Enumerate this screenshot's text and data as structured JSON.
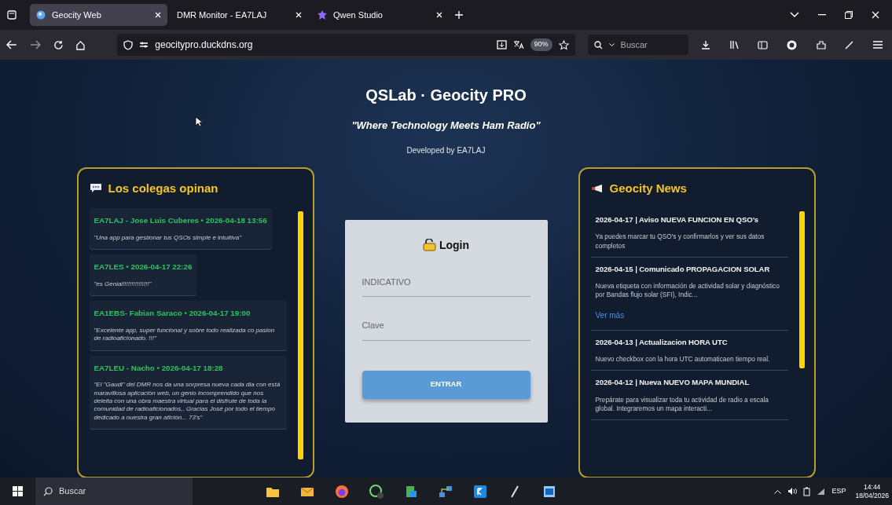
{
  "browser": {
    "tabs": [
      {
        "title": "Geocity Web",
        "selected": true,
        "kind": "globe"
      },
      {
        "title": "DMR Monitor - EA7LAJ",
        "selected": false,
        "kind": "plain"
      },
      {
        "title": "Qwen Studio",
        "selected": false,
        "kind": "star"
      }
    ],
    "url": "geocitypro.duckdns.org",
    "zoom": "90%",
    "search_placeholder": "Buscar"
  },
  "page": {
    "title": "QSLab · Geocity PRO",
    "tagline": "\"Where Technology Meets Ham Radio\"",
    "credit": "Developed by EA7LAJ",
    "opinions": {
      "title": "Los colegas opinan",
      "items": [
        {
          "header": "EA7LAJ - Jose Luis Cuberes • 2026-04-18 13:56",
          "text": "\"Una app para gestionar tus QSOs simple e intuitiva\""
        },
        {
          "header": "EA7LES • 2026-04-17 22:26",
          "text": "\"es Genial!!!!!!!!!!!!!!!\""
        },
        {
          "header": "EA1EBS- Fabian Saraco • 2026-04-17 19:00",
          "text": "\"Excelente app, super funcional y sobre todo realizada co pasion de radioaficionado. !!!\""
        },
        {
          "header": "EA7LEU - Nacho • 2026-04-17 18:28",
          "text": "\"El \"Gaudi\" del DMR nos da una sorpresa nueva cada dia con está maravillosa aplicación web, un genio incomprendido que nos deleita con una obra maestra virtual para el disfrute de toda la comunidad de radioaficionados,. Gracias José por todo el tiempo dedicado a nuestra gran afición... 73's\""
        }
      ]
    },
    "login": {
      "title": "Login",
      "fields": [
        {
          "placeholder": "INDICATIVO"
        },
        {
          "placeholder": "Clave"
        }
      ],
      "button": "ENTRAR"
    },
    "news": {
      "title": "Geocity News",
      "items": [
        {
          "title": "2026-04-17 | Aviso NUEVA FUNCION EN QSO's",
          "text": "Ya puedes marcar tu QSO's y confirmarlos y ver sus datos completos"
        },
        {
          "title": "2026-04-15 | Comunicado PROPAGACION SOLAR",
          "text": "Nueva etiqueta con información de actividad solar y diagnóstico por Bandas flujo solar (SFI), Indic...",
          "link": "Ver más"
        },
        {
          "title": "2026-04-13 | Actualizacion HORA UTC",
          "text": "Nuevo checkbox con la hora UTC automaticaen tiempo real."
        },
        {
          "title": "2026-04-12 | Nueva NUEVO MAPA MUNDIAL",
          "text": "Prepárate para visualizar toda tu actividad de radio a escala global. Integraremos un mapa interacti..."
        }
      ]
    }
  },
  "taskbar": {
    "search_placeholder": "Buscar",
    "language": "ESP",
    "time": "14:44",
    "date": "18/04/2026"
  }
}
